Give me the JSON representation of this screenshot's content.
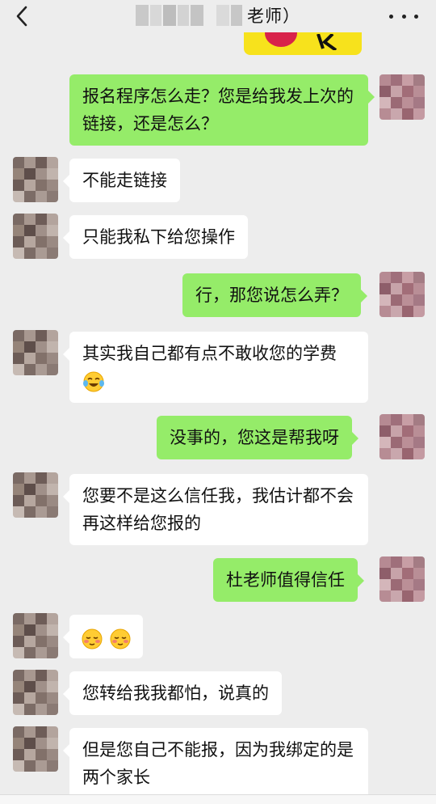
{
  "header": {
    "title_suffix": "老师）",
    "back_icon": "chevron-left-icon",
    "more_icon": "more-dots-icon"
  },
  "messages": [
    {
      "side": "out",
      "text": "报名程序怎么走？您是给我发上次的链接，还是怎么？"
    },
    {
      "side": "in",
      "text": "不能走链接"
    },
    {
      "side": "in",
      "text": "只能我私下给您操作"
    },
    {
      "side": "out",
      "text": "行，那您说怎么弄？"
    },
    {
      "side": "in",
      "text": "其实我自己都有点不敢收您的学费",
      "emoji": "tears-of-joy-emoji"
    },
    {
      "side": "out",
      "text": "没事的，您这是帮我呀"
    },
    {
      "side": "in",
      "text": "您要不是这么信任我，我估计都不会再这样给您报的"
    },
    {
      "side": "out",
      "text": "杜老师值得信任"
    },
    {
      "side": "in",
      "text": "",
      "emoji": "blushing-face-emoji x2"
    },
    {
      "side": "in",
      "text": "您转给我我都怕，说真的"
    },
    {
      "side": "in",
      "text": "但是您自己不能报，因为我绑定的是两个家长"
    }
  ],
  "colors": {
    "background": "#ededed",
    "bubble_out": "#95ec69",
    "bubble_in": "#ffffff"
  }
}
